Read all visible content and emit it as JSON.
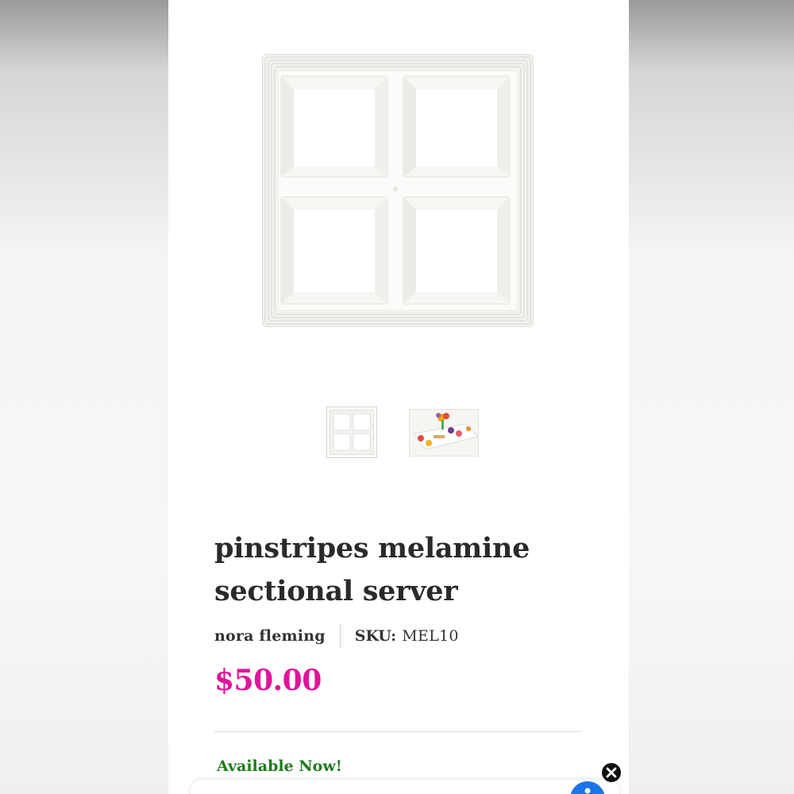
{
  "product": {
    "title": "pinstripes melamine sectional server",
    "brand": "nora fleming",
    "sku_label": "SKU:",
    "sku_value": "MEL10",
    "price": "$50.00",
    "availability": "Available Now!"
  },
  "gallery": {
    "thumbnails": [
      "sectional-server-thumbnail",
      "styled-table-thumbnail"
    ]
  },
  "colors": {
    "price": "#e0159a",
    "availability": "#1e7a1e",
    "accessibility_button": "#1a73e8"
  },
  "icons": {
    "close": "close-icon",
    "accessibility": "accessibility-icon"
  }
}
